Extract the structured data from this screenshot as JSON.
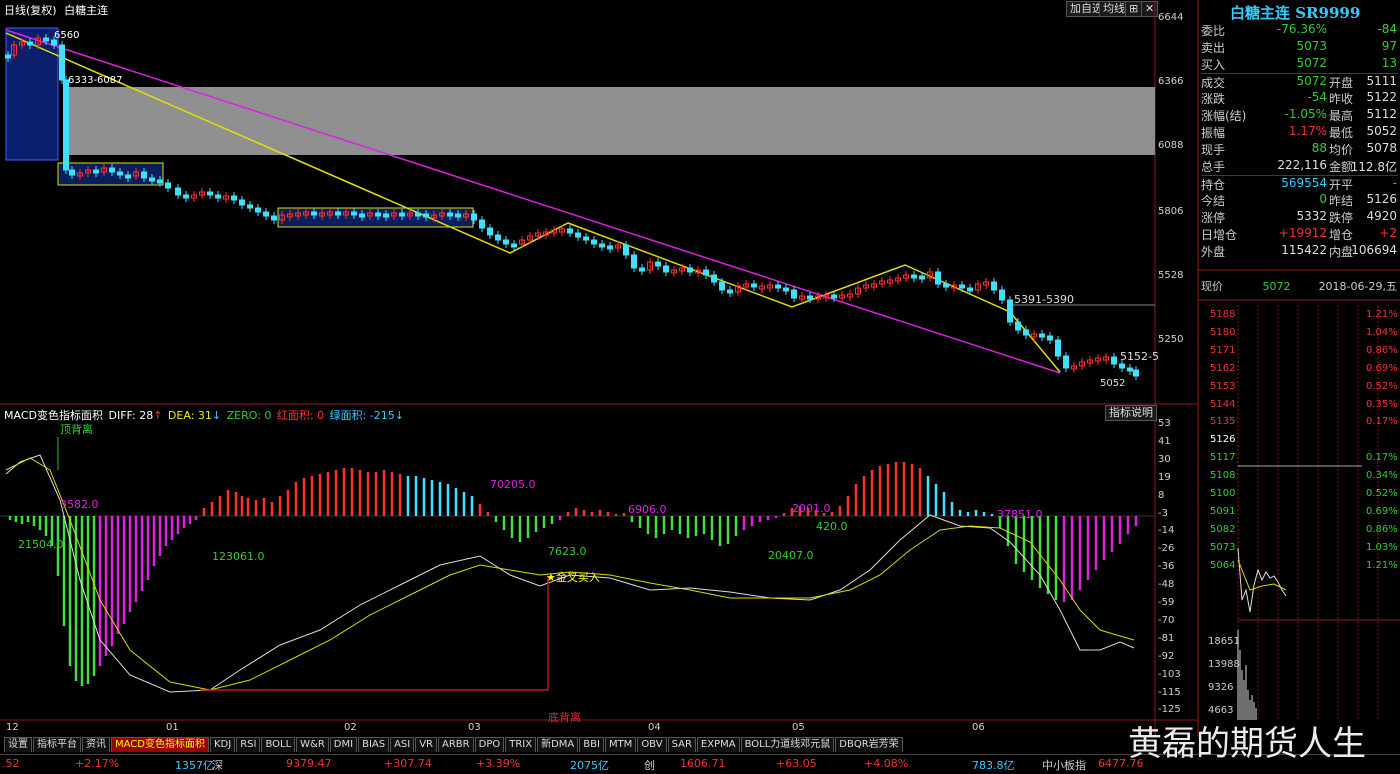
{
  "top": {
    "period_label": "日线(复权)",
    "symbol_name": "白糖主连",
    "add_self_select": "加自选",
    "ma_toggle": "均线",
    "menu_glyph": "⊞",
    "close_glyph": "✕"
  },
  "price_axis": [
    "6644",
    "6366",
    "6088",
    "5806",
    "5528",
    "5250"
  ],
  "chart_annotations": {
    "high_label": "6560",
    "gap_label": "6333-6087",
    "support_label": "5391-5390",
    "recent_label": "5152-5",
    "low_label": "5052"
  },
  "macd": {
    "title": "MACD变色指标面积",
    "diff": "DIFF: 28",
    "dea": "DEA: 31",
    "zero": "ZERO: 0",
    "red_area": "红面积: 0",
    "green_area": "绿面积: -215",
    "explain_button": "指标说明",
    "top_divergence": "顶背离",
    "bottom_divergence": "底背离",
    "golden_cross": "金叉买入",
    "axis": [
      "53",
      "41",
      "30",
      "19",
      "8",
      "-3",
      "-14",
      "-26",
      "-36",
      "-48",
      "-59",
      "-70",
      "-81",
      "-92",
      "-103",
      "-115",
      "-125"
    ],
    "area_labels": [
      "3582.0",
      "21504.0",
      "123061.0",
      "70205.0",
      "7623.0",
      "6906.0",
      "2001.0",
      "420.0",
      "20407.0",
      "37851.0"
    ]
  },
  "months": [
    "12",
    "01",
    "02",
    "03",
    "04",
    "05",
    "06"
  ],
  "quote": {
    "title": "白糖主连 SR9999",
    "rows": [
      {
        "k1": "委比",
        "v1": "-76.36%",
        "k2": "",
        "v2": "-84"
      },
      {
        "k1": "卖出",
        "v1": "5073",
        "k2": "",
        "v2": "97"
      },
      {
        "k1": "买入",
        "v1": "5072",
        "k2": "",
        "v2": "13"
      },
      {
        "k1": "成交",
        "v1": "5072",
        "k2": "开盘",
        "v2": "5111"
      },
      {
        "k1": "涨跌",
        "v1": "-54",
        "k2": "昨收",
        "v2": "5122"
      },
      {
        "k1": "涨幅(结)",
        "v1": "-1.05%",
        "k2": "最高",
        "v2": "5112"
      },
      {
        "k1": "振幅",
        "v1": "1.17%",
        "k2": "最低",
        "v2": "5052"
      },
      {
        "k1": "现手",
        "v1": "88",
        "k2": "均价",
        "v2": "5078"
      },
      {
        "k1": "总手",
        "v1": "222,116",
        "k2": "金额",
        "v2": "112.8亿"
      },
      {
        "k1": "持仓",
        "v1": "569554",
        "k2": "开平",
        "v2": "-"
      },
      {
        "k1": "今结",
        "v1": "0",
        "k2": "昨结",
        "v2": "5126"
      },
      {
        "k1": "涨停",
        "v1": "5332",
        "k2": "跌停",
        "v2": "4920"
      },
      {
        "k1": "日增仓",
        "v1": "+19912",
        "k2": "增仓",
        "v2": "+2"
      },
      {
        "k1": "外盘",
        "v1": "115422",
        "k2": "内盘",
        "v2": "106694"
      }
    ],
    "now_label": "现价",
    "now_price": "5072",
    "date": "2018-06-29,五"
  },
  "intraday": {
    "prices": [
      "5188",
      "5180",
      "5171",
      "5162",
      "5153",
      "5144",
      "5135",
      "5126",
      "5117",
      "5108",
      "5100",
      "5091",
      "5082",
      "5073",
      "5064"
    ],
    "pcts": [
      "1.21%",
      "1.04%",
      "0.86%",
      "0.69%",
      "0.52%",
      "0.35%",
      "0.17%",
      "",
      "0.17%",
      "0.34%",
      "0.52%",
      "0.69%",
      "0.86%",
      "1.03%",
      "1.21%"
    ],
    "vols": [
      "18651",
      "13988",
      "9326",
      "4663"
    ]
  },
  "tabs": [
    "设置",
    "指标平台",
    "资讯",
    "MACD变色指标面积",
    "KDJ",
    "RSI",
    "BOLL",
    "W&R",
    "DMI",
    "BIAS",
    "ASI",
    "VR",
    "ARBR",
    "DPO",
    "TRIX",
    "新DMA",
    "BBI",
    "MTM",
    "OBV",
    "SAR",
    "EXPMA",
    "BOLL力道线邓元鼠",
    "DBQR岩芳荣"
  ],
  "status": {
    "s1": ".52",
    "s2": "+2.17%",
    "s3": "1357亿",
    "s4": "深",
    "s5": "9379.47",
    "s6": "+307.74",
    "s7": "+3.39%",
    "s8": "2075亿",
    "s9": "创",
    "s10": "1606.71",
    "s11": "+63.05",
    "s12": "+4.08%",
    "s13": "783.8亿",
    "s14": "中小板指",
    "s15": "6477.76"
  },
  "watermark": "黄磊的期货人生"
}
